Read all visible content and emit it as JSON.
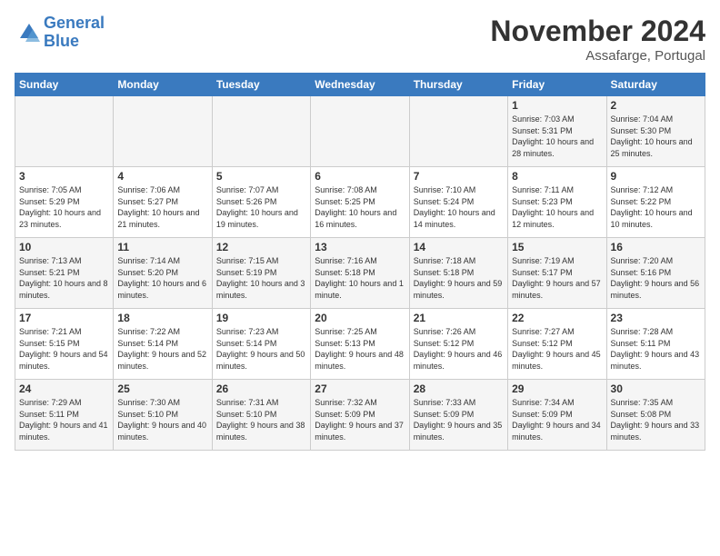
{
  "logo": {
    "line1": "General",
    "line2": "Blue"
  },
  "title": "November 2024",
  "location": "Assafarge, Portugal",
  "days_of_week": [
    "Sunday",
    "Monday",
    "Tuesday",
    "Wednesday",
    "Thursday",
    "Friday",
    "Saturday"
  ],
  "weeks": [
    [
      {
        "day": "",
        "text": ""
      },
      {
        "day": "",
        "text": ""
      },
      {
        "day": "",
        "text": ""
      },
      {
        "day": "",
        "text": ""
      },
      {
        "day": "",
        "text": ""
      },
      {
        "day": "1",
        "text": "Sunrise: 7:03 AM\nSunset: 5:31 PM\nDaylight: 10 hours\nand 28 minutes."
      },
      {
        "day": "2",
        "text": "Sunrise: 7:04 AM\nSunset: 5:30 PM\nDaylight: 10 hours\nand 25 minutes."
      }
    ],
    [
      {
        "day": "3",
        "text": "Sunrise: 7:05 AM\nSunset: 5:29 PM\nDaylight: 10 hours\nand 23 minutes."
      },
      {
        "day": "4",
        "text": "Sunrise: 7:06 AM\nSunset: 5:27 PM\nDaylight: 10 hours\nand 21 minutes."
      },
      {
        "day": "5",
        "text": "Sunrise: 7:07 AM\nSunset: 5:26 PM\nDaylight: 10 hours\nand 19 minutes."
      },
      {
        "day": "6",
        "text": "Sunrise: 7:08 AM\nSunset: 5:25 PM\nDaylight: 10 hours\nand 16 minutes."
      },
      {
        "day": "7",
        "text": "Sunrise: 7:10 AM\nSunset: 5:24 PM\nDaylight: 10 hours\nand 14 minutes."
      },
      {
        "day": "8",
        "text": "Sunrise: 7:11 AM\nSunset: 5:23 PM\nDaylight: 10 hours\nand 12 minutes."
      },
      {
        "day": "9",
        "text": "Sunrise: 7:12 AM\nSunset: 5:22 PM\nDaylight: 10 hours\nand 10 minutes."
      }
    ],
    [
      {
        "day": "10",
        "text": "Sunrise: 7:13 AM\nSunset: 5:21 PM\nDaylight: 10 hours\nand 8 minutes."
      },
      {
        "day": "11",
        "text": "Sunrise: 7:14 AM\nSunset: 5:20 PM\nDaylight: 10 hours\nand 6 minutes."
      },
      {
        "day": "12",
        "text": "Sunrise: 7:15 AM\nSunset: 5:19 PM\nDaylight: 10 hours\nand 3 minutes."
      },
      {
        "day": "13",
        "text": "Sunrise: 7:16 AM\nSunset: 5:18 PM\nDaylight: 10 hours\nand 1 minute."
      },
      {
        "day": "14",
        "text": "Sunrise: 7:18 AM\nSunset: 5:18 PM\nDaylight: 9 hours\nand 59 minutes."
      },
      {
        "day": "15",
        "text": "Sunrise: 7:19 AM\nSunset: 5:17 PM\nDaylight: 9 hours\nand 57 minutes."
      },
      {
        "day": "16",
        "text": "Sunrise: 7:20 AM\nSunset: 5:16 PM\nDaylight: 9 hours\nand 56 minutes."
      }
    ],
    [
      {
        "day": "17",
        "text": "Sunrise: 7:21 AM\nSunset: 5:15 PM\nDaylight: 9 hours\nand 54 minutes."
      },
      {
        "day": "18",
        "text": "Sunrise: 7:22 AM\nSunset: 5:14 PM\nDaylight: 9 hours\nand 52 minutes."
      },
      {
        "day": "19",
        "text": "Sunrise: 7:23 AM\nSunset: 5:14 PM\nDaylight: 9 hours\nand 50 minutes."
      },
      {
        "day": "20",
        "text": "Sunrise: 7:25 AM\nSunset: 5:13 PM\nDaylight: 9 hours\nand 48 minutes."
      },
      {
        "day": "21",
        "text": "Sunrise: 7:26 AM\nSunset: 5:12 PM\nDaylight: 9 hours\nand 46 minutes."
      },
      {
        "day": "22",
        "text": "Sunrise: 7:27 AM\nSunset: 5:12 PM\nDaylight: 9 hours\nand 45 minutes."
      },
      {
        "day": "23",
        "text": "Sunrise: 7:28 AM\nSunset: 5:11 PM\nDaylight: 9 hours\nand 43 minutes."
      }
    ],
    [
      {
        "day": "24",
        "text": "Sunrise: 7:29 AM\nSunset: 5:11 PM\nDaylight: 9 hours\nand 41 minutes."
      },
      {
        "day": "25",
        "text": "Sunrise: 7:30 AM\nSunset: 5:10 PM\nDaylight: 9 hours\nand 40 minutes."
      },
      {
        "day": "26",
        "text": "Sunrise: 7:31 AM\nSunset: 5:10 PM\nDaylight: 9 hours\nand 38 minutes."
      },
      {
        "day": "27",
        "text": "Sunrise: 7:32 AM\nSunset: 5:09 PM\nDaylight: 9 hours\nand 37 minutes."
      },
      {
        "day": "28",
        "text": "Sunrise: 7:33 AM\nSunset: 5:09 PM\nDaylight: 9 hours\nand 35 minutes."
      },
      {
        "day": "29",
        "text": "Sunrise: 7:34 AM\nSunset: 5:09 PM\nDaylight: 9 hours\nand 34 minutes."
      },
      {
        "day": "30",
        "text": "Sunrise: 7:35 AM\nSunset: 5:08 PM\nDaylight: 9 hours\nand 33 minutes."
      }
    ]
  ]
}
